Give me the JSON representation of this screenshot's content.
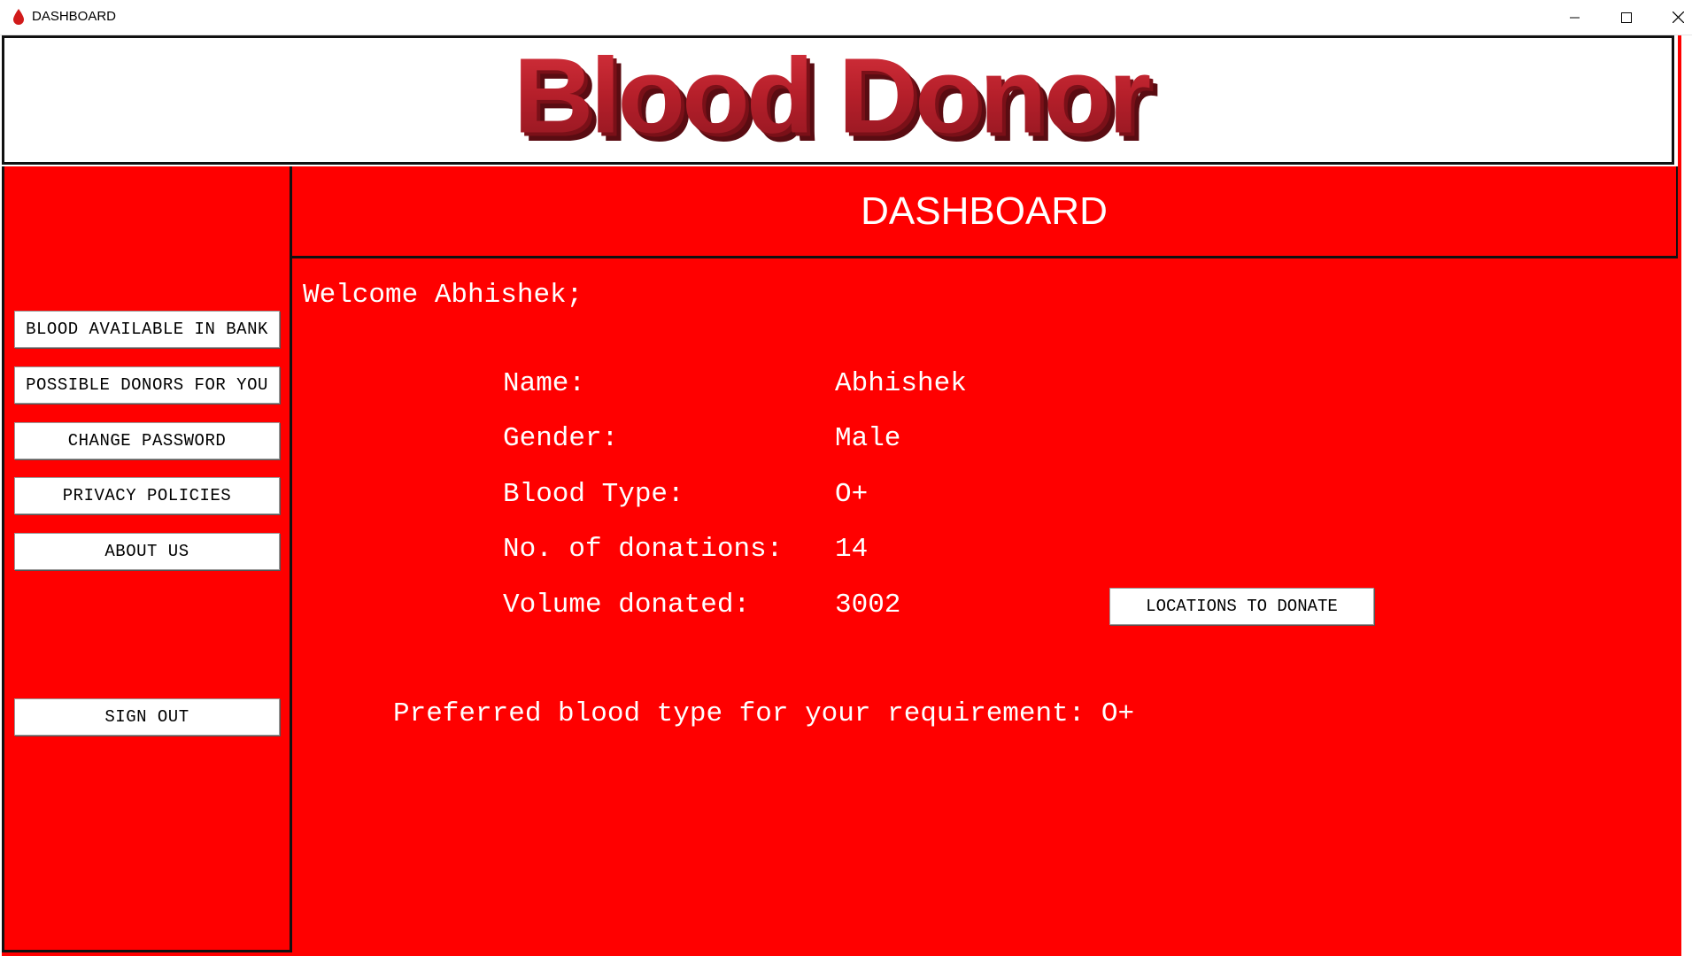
{
  "window": {
    "title": "DASHBOARD",
    "controls": [
      "minimize",
      "maximize",
      "close"
    ]
  },
  "banner": {
    "logo_text": "Blood Donor",
    "logo_color": "#b5202b"
  },
  "colors": {
    "background": "#ff0000",
    "text": "#ffffff",
    "button_bg": "#ffffff"
  },
  "sidebar": {
    "buttons": [
      {
        "label": "BLOOD AVAILABLE IN BANK"
      },
      {
        "label": "POSSIBLE DONORS FOR YOU"
      },
      {
        "label": "CHANGE PASSWORD"
      },
      {
        "label": "PRIVACY POLICIES"
      },
      {
        "label": "ABOUT US"
      }
    ],
    "sign_out_label": "SIGN OUT"
  },
  "main": {
    "header": "DASHBOARD",
    "welcome": "Welcome Abhishek;",
    "details": [
      {
        "label": "Name:",
        "value": "Abhishek"
      },
      {
        "label": "Gender:",
        "value": "Male"
      },
      {
        "label": "Blood Type:",
        "value": "O+"
      },
      {
        "label": "No. of donations:",
        "value": "14"
      },
      {
        "label": "Volume donated:",
        "value": "3002"
      }
    ],
    "locations_button": "LOCATIONS TO DONATE",
    "preferred": "Preferred blood type for your requirement: O+"
  }
}
